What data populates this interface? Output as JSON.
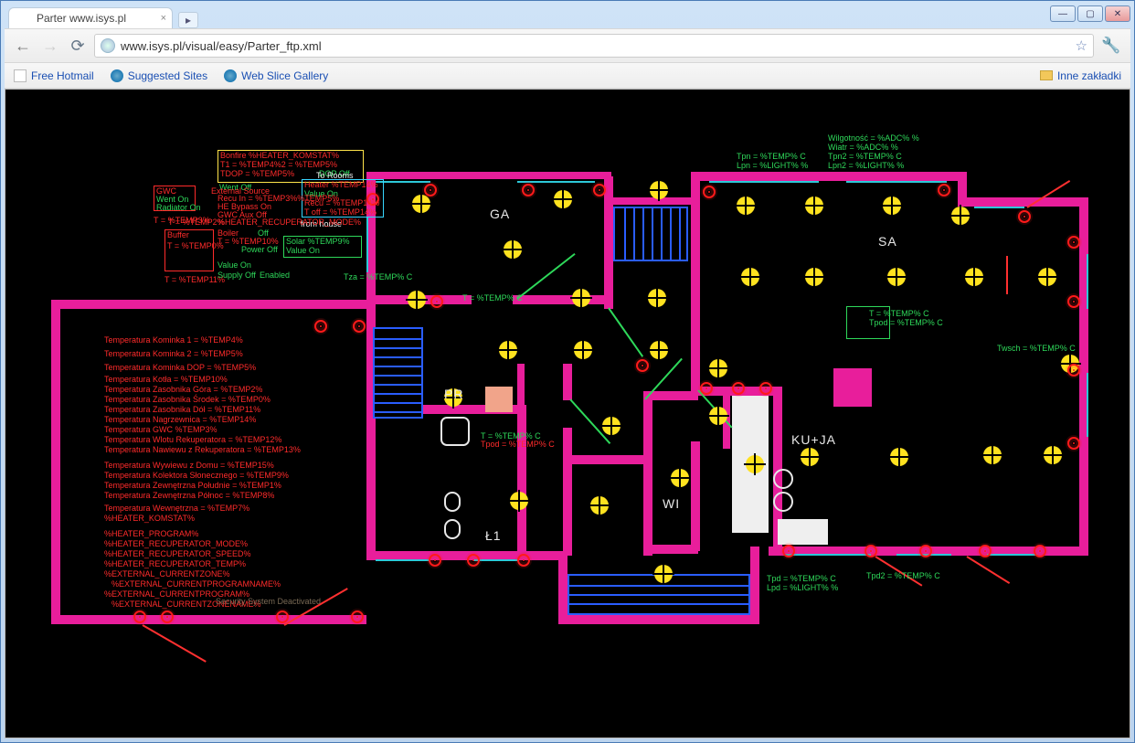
{
  "window": {
    "tab_title": "Parter www.isys.pl",
    "url": "www.isys.pl/visual/easy/Parter_ftp.xml"
  },
  "bookmarks": {
    "b1": "Free Hotmail",
    "b2": "Suggested Sites",
    "b3": "Web Slice Gallery",
    "other": "Inne zakładki"
  },
  "rooms": {
    "ga": "GA",
    "sa": "SA",
    "pr": "PR",
    "kuja": "KU+JA",
    "wi": "WI",
    "l1": "Ł1"
  },
  "topright": {
    "wilg": "Wilgotność = %ADC% %",
    "wiatr": "Wiatr = %ADC% %",
    "tpn2": "Tpn2 = %TEMP% C",
    "lpn2": "Lpn2 = %LIGHT% %",
    "tpn": "Tpn = %TEMP% C",
    "lpn": "Lpn = %LIGHT% %"
  },
  "right": {
    "t_sa": "T = %TEMP% C",
    "tpod_sa": "Tpod = %TEMP% C",
    "twsch": "Twsch = %TEMP% C"
  },
  "bottom": {
    "tpd": "Tpd = %TEMP% C",
    "lpd": "Lpd = %LIGHT% %",
    "tpd2": "Tpd2 = %TEMP% C"
  },
  "center": {
    "tza": "Tza = %TEMP% C",
    "t_ga": "T = %TEMP% C",
    "t_pr": "T = %TEMP% C",
    "tpod_pr": "Tpod = %TEMP% C"
  },
  "bonfire": {
    "title": "Bonfire %HEATER_KOMSTAT%",
    "t1": "T1 = %TEMP4%2 = %TEMP5%",
    "tdop": "TDOP = %TEMP5%",
    "dop": "DOP Off",
    "went": "Went Off"
  },
  "heater": {
    "title": "Heater %TEMP14%",
    "value": "Value On",
    "toff": "T off = %TEMP14%",
    "recu": "Recu   = %TEMP14%"
  },
  "solar": {
    "title": "Solar %TEMP9%",
    "value": "Value On"
  },
  "gwc": {
    "title": "GWC",
    "went": "Went On",
    "rad": "Radiator On"
  },
  "buffer": {
    "title": "Buffer",
    "t": "T = %TEMP0%",
    "t3": "T = %TEMP3%",
    "t11": "T = %TEMP11%",
    "t2": "T = %TEMP2%"
  },
  "boiler": {
    "title": "Boiler",
    "off": "Off",
    "t": "T = %TEMP10%",
    "power": "Power Off",
    "value": "Value On",
    "supply": "Supply Off",
    "enabled": "Enabled"
  },
  "recu": {
    "ext": "External Source",
    "in": "Recu In = %TEMP3%%TEMP5%",
    "bypass": "HE Bypass On",
    "aux": "GWC Aux Off",
    "mode": "%HEATER_RECUPERATOR_MODE%"
  },
  "misc": {
    "to_rooms": "To Rooms",
    "from_house": "from house"
  },
  "leftpanel": {
    "l01": "Temperatura Kominka 1 = %TEMP4%",
    "l02": "Temperatura Kominka 2 = %TEMP5%",
    "l03": "Temperatura Kominka DOP = %TEMP5%",
    "l04": "Temperatura Kotła = %TEMP10%",
    "l05": "Temperatura Zasobnika Góra = %TEMP2%",
    "l06": "Temperatura Zasobnika Środek = %TEMP0%",
    "l07": "Temperatura Zasobnika Dół = %TEMP11%",
    "l08": "Temperatura Nagrzewnica = %TEMP14%",
    "l09": "Temperatura GWC %TEMP3%",
    "l10": "Temperatura Wlotu Rekuperatora = %TEMP12%",
    "l11": "Temperatura Nawiewu z Rekuperatora = %TEMP13%",
    "l12": "Temperatura Wywiewu z Domu = %TEMP15%",
    "l13": "Temperatura Kolektora Słonecznego = %TEMP9%",
    "l14": "Temperatura Zewnętrzna Południe = %TEMP1%",
    "l15": "Temperatura Zewnętrzna Północ = %TEMP8%",
    "l16": "Temperatura Wewnętrzna = %TEMP7%",
    "l17": "%HEATER_KOMSTAT%",
    "l18": "%HEATER_PROGRAM%",
    "l19": "%HEATER_RECUPERATOR_MODE%",
    "l20": "%HEATER_RECUPERATOR_SPEED%",
    "l21": "%HEATER_RECUPERATOR_TEMP%",
    "l22": "%EXTERNAL_CURRENTZONE%",
    "l23": "%EXTERNAL_CURRENTPROGRAMNAME%",
    "l24": "%EXTERNAL_CURRENTPROGRAM%",
    "l25": "%EXTERNAL_CURRENTZONENAME%"
  },
  "security": "Security System Deactivated"
}
